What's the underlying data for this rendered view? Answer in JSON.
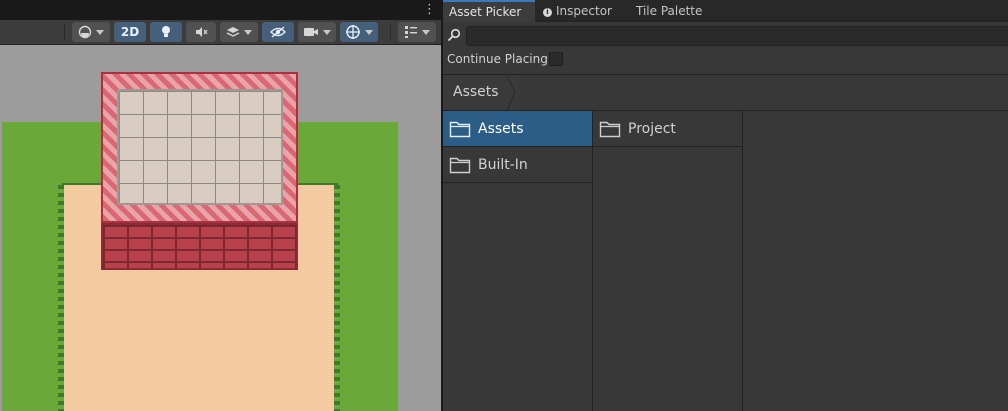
{
  "colors": {
    "accent": "#2c5d87",
    "panel": "#383838",
    "grass": "#6aa83a",
    "sand": "#f4caa0",
    "roof": "#d96872"
  },
  "scene_toolbar": {
    "shading_icon": "shading-sphere-icon",
    "mode_2d_label": "2D",
    "lighting_icon": "lightbulb-icon",
    "audio_icon": "audio-mute-icon",
    "fx_icon": "fx-layers-icon",
    "visibility_icon": "hidden-eye-icon",
    "camera_icon": "camera-icon",
    "gizmos_icon": "gizmo-target-icon",
    "overlays_icon": "overlays-grid-icon"
  },
  "tabs": [
    {
      "label": "Asset Picker"
    },
    {
      "label": "Inspector"
    },
    {
      "label": "Tile Palette"
    }
  ],
  "search": {
    "value": "",
    "placeholder": ""
  },
  "continue_placing": {
    "label": "Continue Placing",
    "checked": false
  },
  "breadcrumb": {
    "label": "Assets"
  },
  "columns": {
    "roots": [
      {
        "label": "Assets",
        "icon": "folder-icon",
        "selected": true
      },
      {
        "label": "Built-In",
        "icon": "folder-icon",
        "selected": false
      }
    ],
    "children": [
      {
        "label": "Project",
        "icon": "folder-icon",
        "selected": false
      }
    ]
  }
}
